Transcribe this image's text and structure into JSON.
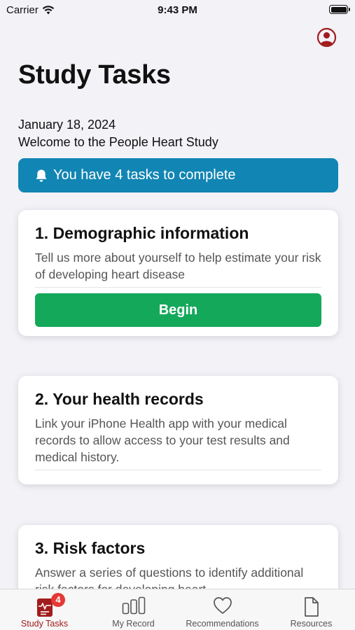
{
  "status_bar": {
    "carrier": "Carrier",
    "time": "9:43 PM"
  },
  "header": {
    "title": "Study Tasks"
  },
  "intro": {
    "date": "January 18, 2024",
    "welcome": "Welcome to the People Heart Study"
  },
  "banner": {
    "text": "You have 4 tasks to complete",
    "color": "#1185b3"
  },
  "tasks": [
    {
      "title": "1. Demographic information",
      "description": "Tell us more about yourself to help estimate your risk of developing heart disease",
      "button": "Begin"
    },
    {
      "title": "2. Your health records",
      "description": "Link your iPhone Health app with your medical records to allow access to your test results and medical history."
    },
    {
      "title": "3. Risk factors",
      "description": "Answer a series of questions to identify additional risk factors for developing heart"
    }
  ],
  "tabbar": {
    "items": [
      {
        "label": "Study Tasks",
        "icon": "clipboard-heart-icon",
        "badge": "4",
        "active": true
      },
      {
        "label": "My Record",
        "icon": "bar-chart-icon"
      },
      {
        "label": "Recommendations",
        "icon": "heart-icon"
      },
      {
        "label": "Resources",
        "icon": "document-icon"
      }
    ]
  },
  "colors": {
    "accent": "#a11c1c",
    "primary_button": "#14a85b",
    "banner": "#1185b3"
  }
}
